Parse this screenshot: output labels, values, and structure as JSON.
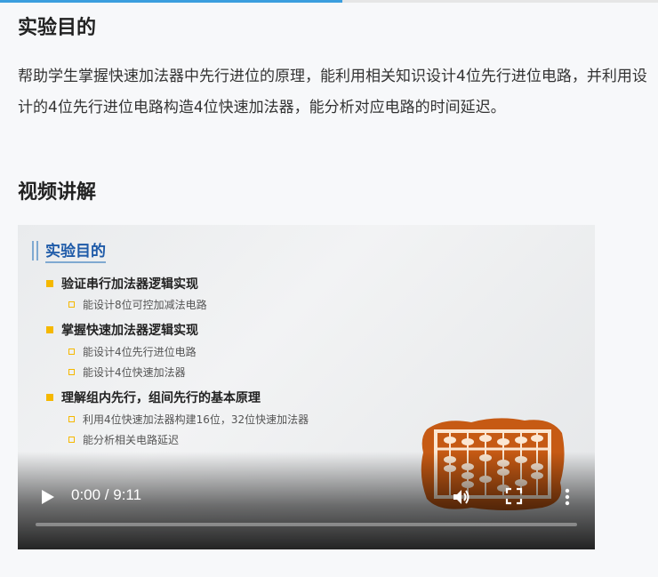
{
  "page": {
    "reading_progress": 0.52,
    "heading_purpose": "实验目的",
    "purpose_text": "帮助学生掌握快速加法器中先行进位的原理，能利用相关知识设计4位先行进位电路，并利用设计的4位先行进位电路构造4位快速加法器，能分析对应电路的时间延迟。",
    "heading_video": "视频讲解"
  },
  "video": {
    "slide": {
      "title": "实验目的",
      "sections": [
        {
          "label": "验证串行加法器逻辑实现",
          "items": [
            "能设计8位可控加减法电路"
          ]
        },
        {
          "label": "掌握快速加法器逻辑实现",
          "items": [
            "能设计4位先行进位电路",
            "能设计4位快速加法器"
          ]
        },
        {
          "label": "理解组内先行，组间先行的基本原理",
          "items": [
            "利用4位快速加法器构建16位，32位快速加法器",
            "能分析相关电路延迟"
          ]
        }
      ]
    },
    "controls": {
      "time": "0:00 / 9:11",
      "play_icon": "play-icon",
      "volume_icon": "volume-icon",
      "fullscreen_icon": "fullscreen-icon",
      "more_icon": "more-vert-icon",
      "progress": 0
    },
    "colors": {
      "accent_bullet": "#f5b800",
      "slide_title": "#1e5aa8",
      "abacus": "#c65a14"
    }
  }
}
